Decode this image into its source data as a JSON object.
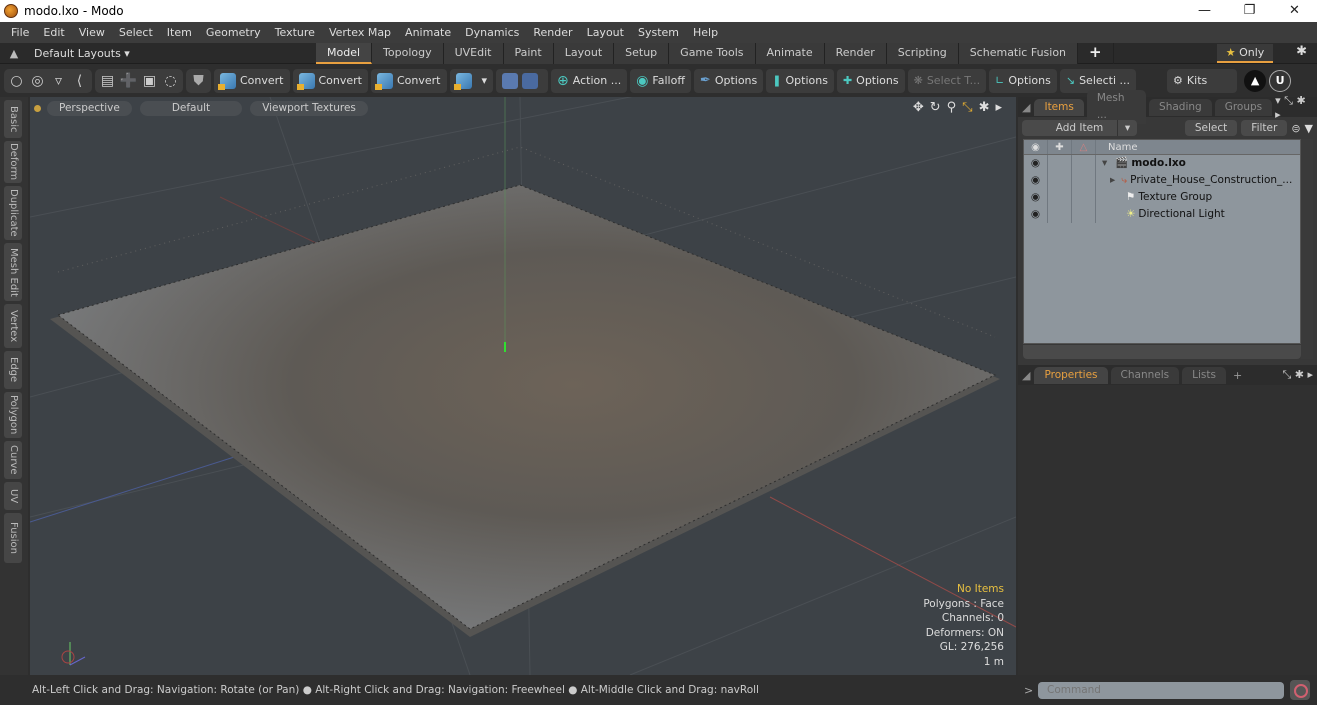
{
  "window": {
    "title": "modo.lxo - Modo",
    "controls": [
      "minimize",
      "restore",
      "close"
    ]
  },
  "menu": [
    "File",
    "Edit",
    "View",
    "Select",
    "Item",
    "Geometry",
    "Texture",
    "Vertex Map",
    "Animate",
    "Dynamics",
    "Render",
    "Layout",
    "System",
    "Help"
  ],
  "layoutbar": {
    "layouts_label": "Default Layouts ▾",
    "tabs": [
      "Model",
      "Topology",
      "UVEdit",
      "Paint",
      "Layout",
      "Setup",
      "Game Tools",
      "Animate",
      "Render",
      "Scripting",
      "Schematic Fusion"
    ],
    "active_tab": "Model",
    "add": "+",
    "only_label": "Only"
  },
  "toolbar": {
    "convert1": "Convert",
    "convert2": "Convert",
    "convert3": "Convert",
    "action": "Action ...",
    "falloff": "Falloff",
    "options1": "Options",
    "options2": "Options",
    "options3": "Options",
    "select_t": "Select T...",
    "options4": "Options",
    "selecti": "Selecti ...",
    "kits": "Kits"
  },
  "left_tabs": [
    "Basic",
    "Deform",
    "Duplicate",
    "Mesh Edit",
    "Vertex",
    "Edge",
    "Polygon",
    "Curve",
    "UV",
    "Fusion"
  ],
  "viewport": {
    "view": "Perspective",
    "shading": "Default",
    "textures": "Viewport Textures",
    "hud": {
      "selection": "No Items",
      "polygons": "Polygons : Face",
      "channels": "Channels: 0",
      "deformers": "Deformers: ON",
      "gl": "GL: 276,256",
      "scale": "1 m"
    }
  },
  "items_panel": {
    "tabs": [
      "Items",
      "Mesh ...",
      "Shading",
      "Groups"
    ],
    "active_tab": "Items",
    "add_item": "Add Item",
    "select": "Select",
    "filter": "Filter",
    "name_header": "Name",
    "rows": [
      {
        "name": "modo.lxo",
        "bold": true
      },
      {
        "name": "Private_House_Construction_..."
      },
      {
        "name": "Texture Group"
      },
      {
        "name": "Directional Light"
      }
    ]
  },
  "props_panel": {
    "tabs": [
      "Properties",
      "Channels",
      "Lists"
    ],
    "active_tab": "Properties",
    "add": "+"
  },
  "status": {
    "message": "Alt-Left Click and Drag: Navigation: Rotate (or Pan) ● Alt-Right Click and Drag: Navigation: Freewheel ● Alt-Middle Click and Drag: navRoll"
  },
  "command": {
    "placeholder": "Command"
  }
}
